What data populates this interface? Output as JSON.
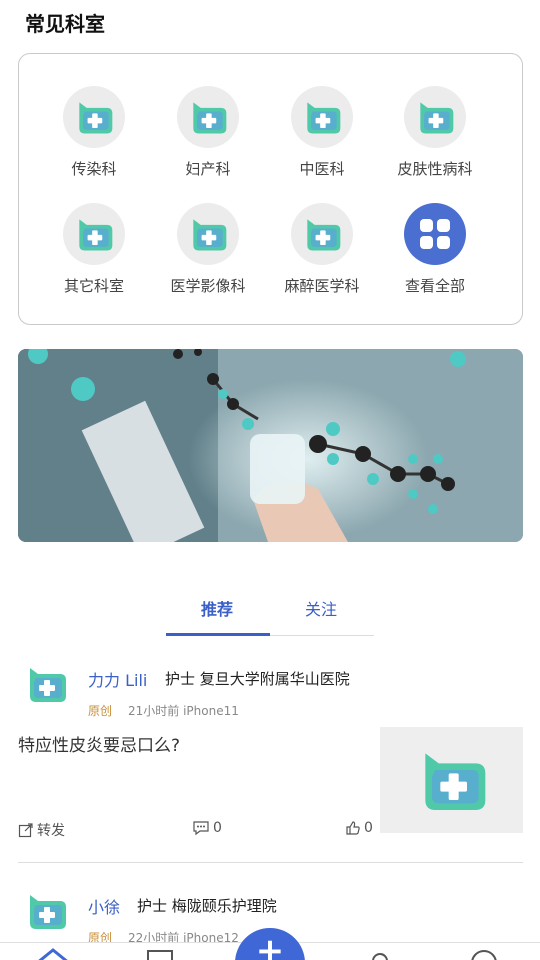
{
  "section_title": "常见科室",
  "departments": [
    {
      "label": "传染科",
      "icon": "department-icon"
    },
    {
      "label": "妇产科",
      "icon": "department-icon"
    },
    {
      "label": "中医科",
      "icon": "department-icon"
    },
    {
      "label": "皮肤性病科",
      "icon": "department-icon"
    },
    {
      "label": "其它科室",
      "icon": "department-icon"
    },
    {
      "label": "医学影像科",
      "icon": "department-icon"
    },
    {
      "label": "麻醉医学科",
      "icon": "department-icon"
    },
    {
      "label": "查看全部",
      "icon": "grid-icon"
    }
  ],
  "tabs": [
    {
      "label": "推荐",
      "active": true
    },
    {
      "label": "关注",
      "active": false
    }
  ],
  "posts": [
    {
      "author": "力力 Lili",
      "role": "护士 复旦大学附属华山医院",
      "origin": "原创",
      "time": "21小时前 iPhone11",
      "text": "特应性皮炎要忌口么?",
      "share_label": "转发",
      "comments": "0",
      "likes": "0"
    },
    {
      "author": "小徐",
      "role": "护士 梅陇颐乐护理院",
      "origin": "原创",
      "time": "22小时前 iPhone12"
    }
  ],
  "colors": {
    "accent": "#3a5fc8",
    "origin": "#c8903a"
  }
}
